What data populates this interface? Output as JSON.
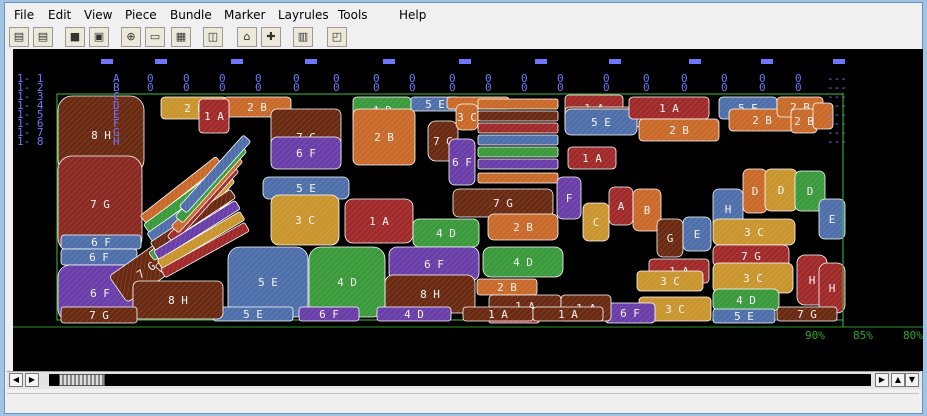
{
  "menu": [
    "File",
    "Edit",
    "View",
    "Piece",
    "Bundle",
    "Marker",
    "Layrules",
    "Tools",
    "Help"
  ],
  "toolbar": [
    {
      "icon": "open-folder-icon",
      "glyph": "▤"
    },
    {
      "icon": "open-marker-icon",
      "glyph": "▤"
    },
    {
      "icon": "save-icon",
      "glyph": "■"
    },
    {
      "icon": "save-all-icon",
      "glyph": "▣"
    },
    {
      "icon": "zoom-icon",
      "glyph": "⊕"
    },
    {
      "icon": "zoom-rectangle-icon",
      "glyph": "▭"
    },
    {
      "icon": "full-view-icon",
      "glyph": "▦"
    },
    {
      "icon": "select-piece-icon",
      "glyph": "◫"
    },
    {
      "icon": "open-file-icon",
      "glyph": "⌂"
    },
    {
      "icon": "add-piece-icon",
      "glyph": "✚"
    },
    {
      "icon": "notes-icon",
      "glyph": "▥"
    },
    {
      "icon": "layout-rules-icon",
      "glyph": "◰"
    }
  ],
  "marker": {
    "row_labels": [
      "1- 1",
      "1- 2",
      "1- 3",
      "1- 4",
      "1- 5",
      "1- 6",
      "1- 7",
      "1- 8"
    ],
    "letter_column": [
      "A",
      "B",
      "C",
      "D",
      "E",
      "F",
      "G",
      "H"
    ],
    "zero_marker": "0",
    "dash_marker": "---",
    "piece_labels": [
      "8 H",
      "7 G",
      "6 F",
      "6 F",
      "6 F",
      "7 G",
      "5 E",
      "4 D",
      "3 C",
      "2 B",
      "1 A",
      "8 H",
      "7 G",
      "6 F",
      "5 E",
      "4 D",
      "3 C",
      "2 B",
      "1 A",
      "8 H",
      "7 G",
      "5 E",
      "4 D",
      "3 C",
      "2 B",
      "1 A",
      "7 G",
      "6 F",
      "4 D",
      "3 C",
      "2 B",
      "1 A",
      "5 E",
      "8 H",
      "7 G",
      "5 E",
      "5 E",
      "6 F",
      "3 C",
      "4 D",
      "8 H",
      "5 E",
      "6 F",
      "4 D",
      "2 B",
      "1 A",
      "3 C",
      "7 G",
      "5 E",
      "7 G",
      "F",
      "C",
      "A",
      "B",
      "G",
      "E",
      "H",
      "H",
      "E",
      "D",
      "C",
      "B",
      "7 G"
    ],
    "efficiency": [
      "90%",
      "85%",
      "80%"
    ]
  },
  "colors": {
    "red": "#8b2a22",
    "orange": "#c96a2a",
    "purple": "#6a3ea8",
    "green": "#3a9a3c",
    "blue": "#4e6faa",
    "tan": "#c9952e",
    "brown": "#6a2a12",
    "crimson": "#a02a2a"
  }
}
